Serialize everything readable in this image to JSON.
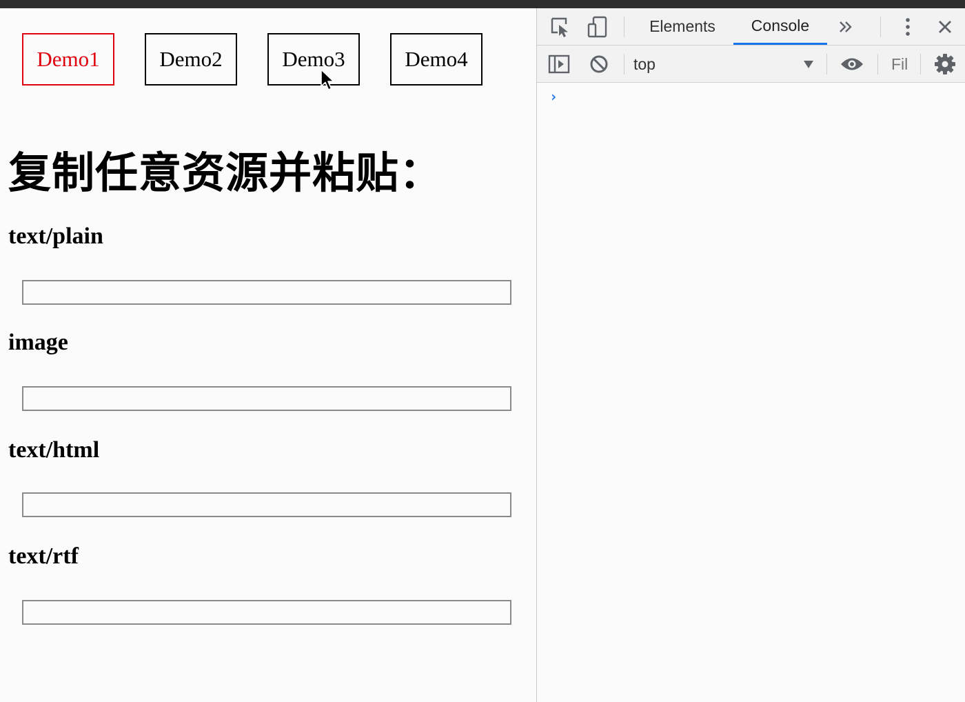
{
  "page": {
    "demo_buttons": [
      {
        "label": "Demo1",
        "active": true
      },
      {
        "label": "Demo2",
        "active": false
      },
      {
        "label": "Demo3",
        "active": false
      },
      {
        "label": "Demo4",
        "active": false
      }
    ],
    "heading": "复制任意资源并粘贴：",
    "sections": [
      {
        "label": "text/plain",
        "value": ""
      },
      {
        "label": "image",
        "value": ""
      },
      {
        "label": "text/html",
        "value": ""
      },
      {
        "label": "text/rtf",
        "value": ""
      }
    ]
  },
  "devtools": {
    "tabs": [
      {
        "label": "Elements",
        "selected": false
      },
      {
        "label": "Console",
        "selected": true
      }
    ],
    "more_tabs_icon": "chevron-double-right-icon",
    "context": "top",
    "filter_placeholder": "Fil",
    "prompt_symbol": "›"
  },
  "colors": {
    "active_demo": "#e0000f",
    "selected_tab_underline": "#1a73e8",
    "prompt": "#1a73e8"
  }
}
